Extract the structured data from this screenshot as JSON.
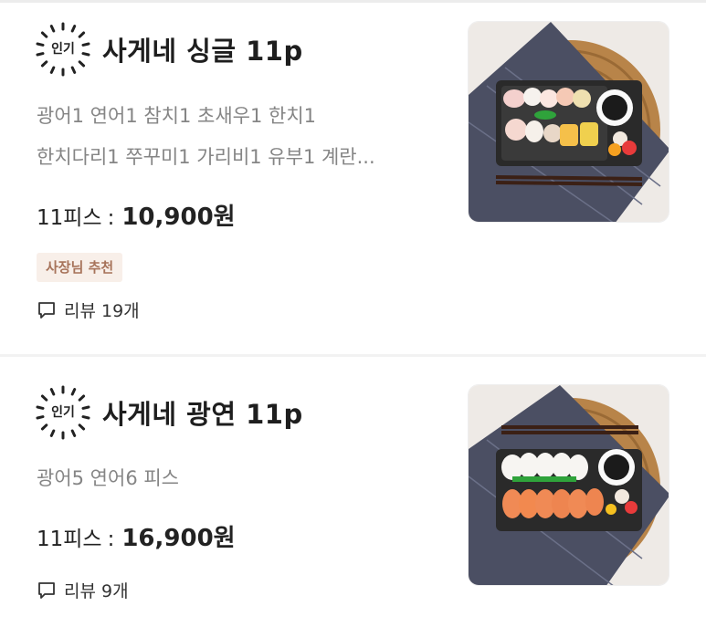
{
  "menu_items": [
    {
      "badge": "인기",
      "title": "사게네 싱글 11p",
      "description_lines": [
        "광어1 연어1 참치1 초새우1 한치1",
        "한치다리1 쭈꾸미1 가리비1 유부1 계란..."
      ],
      "price_label": "11피스",
      "price_separator": ":",
      "price_value": "10,900원",
      "tag": "사장님 추천",
      "review_text": "리뷰 19개",
      "photo_icon": "sushi-platter-image"
    },
    {
      "badge": "인기",
      "title": "사게네 광연 11p",
      "description_lines": [
        "광어5 연어6 피스"
      ],
      "price_label": "11피스",
      "price_separator": ":",
      "price_value": "16,900원",
      "review_text": "리뷰 9개",
      "photo_icon": "salmon-sushi-platter-image"
    }
  ],
  "colors": {
    "tag_bg": "#f8efe9",
    "tag_text": "#a7735a",
    "description": "#858585"
  }
}
